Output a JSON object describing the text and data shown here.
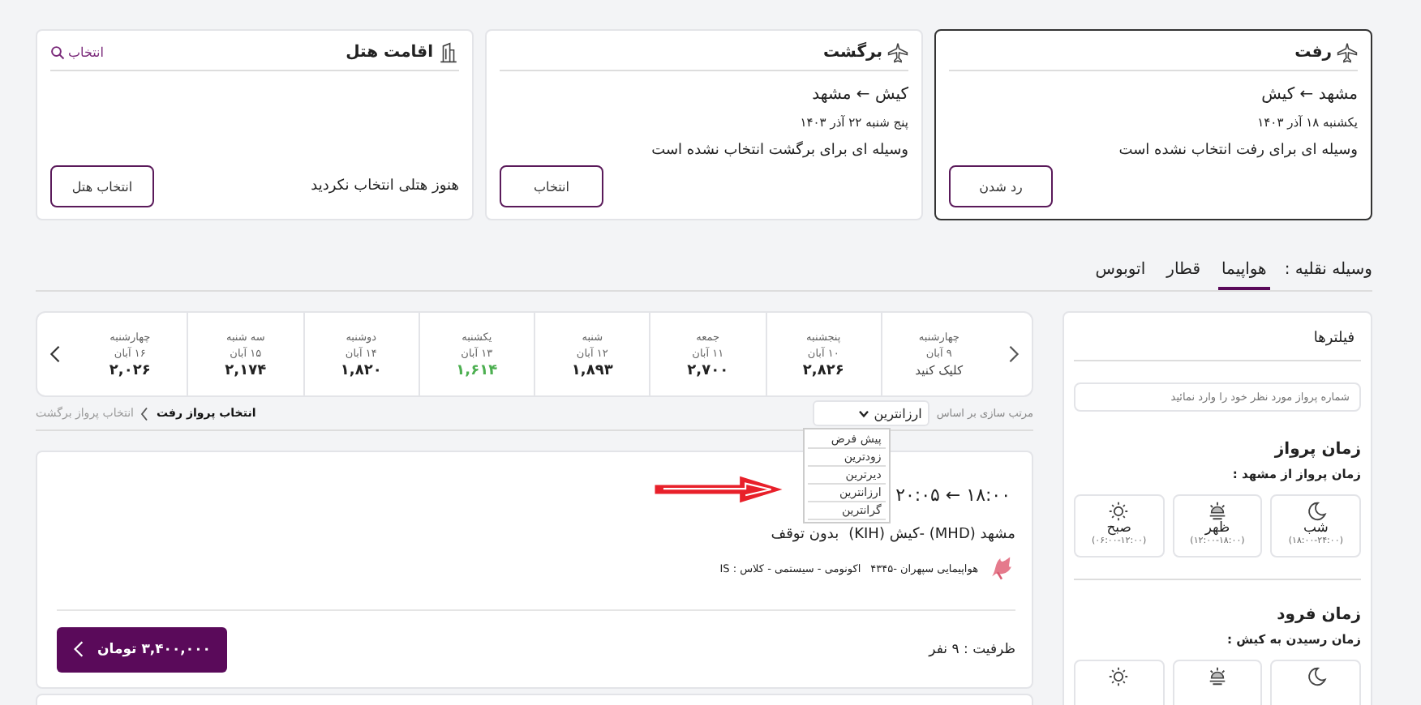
{
  "trips": [
    {
      "title": "رفت",
      "selected": true,
      "route": "مشهد ← کیش",
      "date": "یکشنبه ۱۸ آذر ۱۴۰۳",
      "status": "وسیله ای برای رفت انتخاب نشده است",
      "button": "رد شدن"
    },
    {
      "title": "برگشت",
      "selected": false,
      "route": "کیش ← مشهد",
      "date": "پنج شنبه ۲۲ آذر ۱۴۰۳",
      "status": "وسیله ای برای برگشت انتخاب نشده است",
      "button": "انتخاب"
    }
  ],
  "hotel": {
    "title": "اقامت هتل",
    "link": "انتخاب",
    "status": "هنوز هتلی انتخاب نکردید",
    "button": "انتخاب هتل"
  },
  "vehicle": {
    "label": "وسیله نقلیه :",
    "tabs": [
      {
        "label": "هواپیما",
        "selected": true
      },
      {
        "label": "قطار",
        "selected": false
      },
      {
        "label": "اتوبوس",
        "selected": false
      }
    ]
  },
  "filters": {
    "title": "فیلترها",
    "search": {
      "placeholder": "شماره پرواز مورد نظر خود را وارد نمائید"
    },
    "departure": {
      "title": "زمان پرواز",
      "subtitle": "زمان پرواز از مشهد :",
      "slots": [
        {
          "kind": "night",
          "label": "شب",
          "range": "(۱۸:۰۰-۲۴:۰۰)"
        },
        {
          "kind": "noon",
          "label": "ظهر",
          "range": "(۱۲:۰۰-۱۸:۰۰)"
        },
        {
          "kind": "morning",
          "label": "صبح",
          "range": "(۰۶:۰۰-۱۲:۰۰)"
        }
      ]
    },
    "arrival": {
      "title": "زمان فرود",
      "subtitle": "زمان رسیدن به کیش :",
      "slots": [
        {
          "kind": "night"
        },
        {
          "kind": "noon"
        },
        {
          "kind": "morning"
        }
      ]
    }
  },
  "dates": [
    {
      "day": "چهارشنبه",
      "date": "۹ آبان",
      "price": "کلیک کنید",
      "kind": "prompt",
      "cheapest": false
    },
    {
      "day": "پنجشنبه",
      "date": "۱۰ آبان",
      "price": "۲,۸۲۶",
      "kind": "price",
      "cheapest": false
    },
    {
      "day": "جمعه",
      "date": "۱۱ آبان",
      "price": "۲,۷۰۰",
      "kind": "price",
      "cheapest": false
    },
    {
      "day": "شنبه",
      "date": "۱۲ آبان",
      "price": "۱,۸۹۳",
      "kind": "price",
      "cheapest": false
    },
    {
      "day": "یکشنبه",
      "date": "۱۳ آبان",
      "price": "۱,۶۱۴",
      "kind": "price",
      "cheapest": true
    },
    {
      "day": "دوشنبه",
      "date": "۱۴ آبان",
      "price": "۱,۸۲۰",
      "kind": "price",
      "cheapest": false
    },
    {
      "day": "سه شنبه",
      "date": "۱۵ آبان",
      "price": "۲,۱۷۴",
      "kind": "price",
      "cheapest": false
    },
    {
      "day": "چهارشنبه",
      "date": "۱۶ آبان",
      "price": "۲,۰۲۶",
      "kind": "price",
      "cheapest": false
    }
  ],
  "sort": {
    "label": "مرتب سازی بر اساس",
    "value": "ارزانترین",
    "options": [
      "پیش فرض",
      "زودترین",
      "دیرترین",
      "ارزانترین",
      "گرانترین"
    ]
  },
  "breadcrumb": [
    {
      "label": "انتخاب پرواز رفت",
      "selected": true
    },
    {
      "label": "انتخاب پرواز برگشت",
      "selected": false
    }
  ],
  "flights": [
    {
      "time": "۱۸:۰۰ ← ۲۰:۰۵",
      "route": "مشهد (MHD) -کیش (KIH)",
      "stops": "بدون توقف",
      "airline": "هواپیمایی سپهران -۴۳۴۵",
      "details": "اکونومی - سیستمی - کلاس : IS",
      "capacity": "ظرفیت : ۹ نفر",
      "price": "۳,۴۰۰,۰۰۰ تومان"
    },
    {
      "kind": "cut"
    }
  ]
}
